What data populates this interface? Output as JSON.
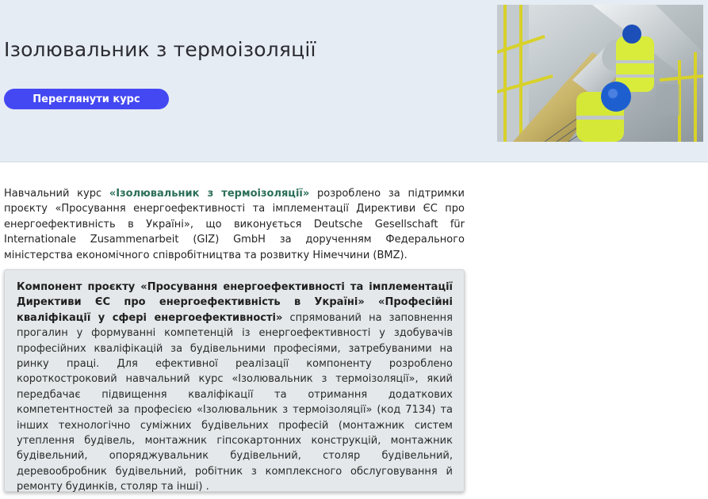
{
  "hero": {
    "title": "Ізолювальник з термоізоляції",
    "cta_label": "Переглянути курс",
    "photo": "pipe-insulation-workers-photo"
  },
  "intro": {
    "p1": "Навчальний курс ",
    "course_name": "«Ізолювальник з термоізоляції»",
    "p2": " розроблено за підтримки проєкту «Просування енергоефективності та імплементації Директиви ЄС про енергоефективність в Україні», що виконується Deutsche Gesellschaft für Internationale Zusammenarbeit (GIZ) GmbH за дорученням Федерального міністерства економічного співробітництва та розвитку Німеччини (BMZ)."
  },
  "note": {
    "bold": "Компонент проєкту «Просування енергоефективності та імплементації Директиви ЄС про енергоефективність в Україні» «Професійні кваліфікації у сфері енергоефективності»",
    "text": " спрямований на заповнення прогалин у формуванні компетенцій із енергоефективності у здобувачів професійних кваліфікацій за будівельними професіями, затребуваними на ринку праці. Для ефективної реалізації компоненту розроблено короткостроковий навчальний курс «Ізолювальник з термоізоляції», який передбачає підвищення кваліфікації та отримання додаткових компетентностей за професією «Ізолювальник з термоізоляції» (код 7134) та інших технологічно суміжних будівельних професій (монтажник систем утеплення будівель, монтажник гіпсокартонних конструкцій, монтажник будівельний, опоряджувальник будівельний, столяр будівельний, деревообробник будівельний, робітник з комплексного обслуговування й ремонту будинків, столяр та інші) ."
  },
  "colors": {
    "accent": "#4448f2",
    "hero_bg": "#e6ecf3",
    "course_highlight": "#2b6f57"
  }
}
